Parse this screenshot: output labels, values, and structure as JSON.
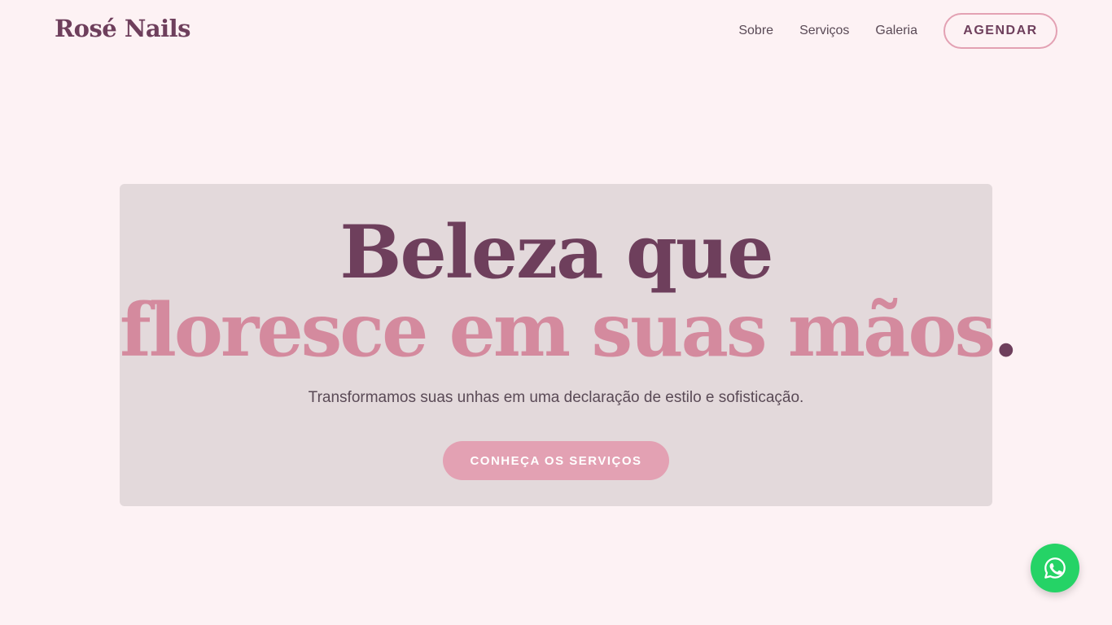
{
  "header": {
    "logo": "Rosé Nails",
    "nav": {
      "sobre": "Sobre",
      "servicos": "Serviços",
      "galeria": "Galeria"
    },
    "cta": "AGENDAR"
  },
  "hero": {
    "line1": "Beleza que",
    "line2": "floresce em suas mãos",
    "line2_punct": ".",
    "subtitle": "Transformamos suas unhas em uma declaração de estilo e sofisticação.",
    "button": "CONHEÇA OS SERVIÇOS"
  },
  "floating": {
    "icon": "whatsapp-icon"
  },
  "colors": {
    "background": "#fdf2f4",
    "primary_dark": "#6e3f5c",
    "accent_pink": "#d48a9e",
    "button_pink": "#e3a1b3",
    "hero_card": "#e3d9db",
    "whatsapp_green": "#25d366"
  }
}
